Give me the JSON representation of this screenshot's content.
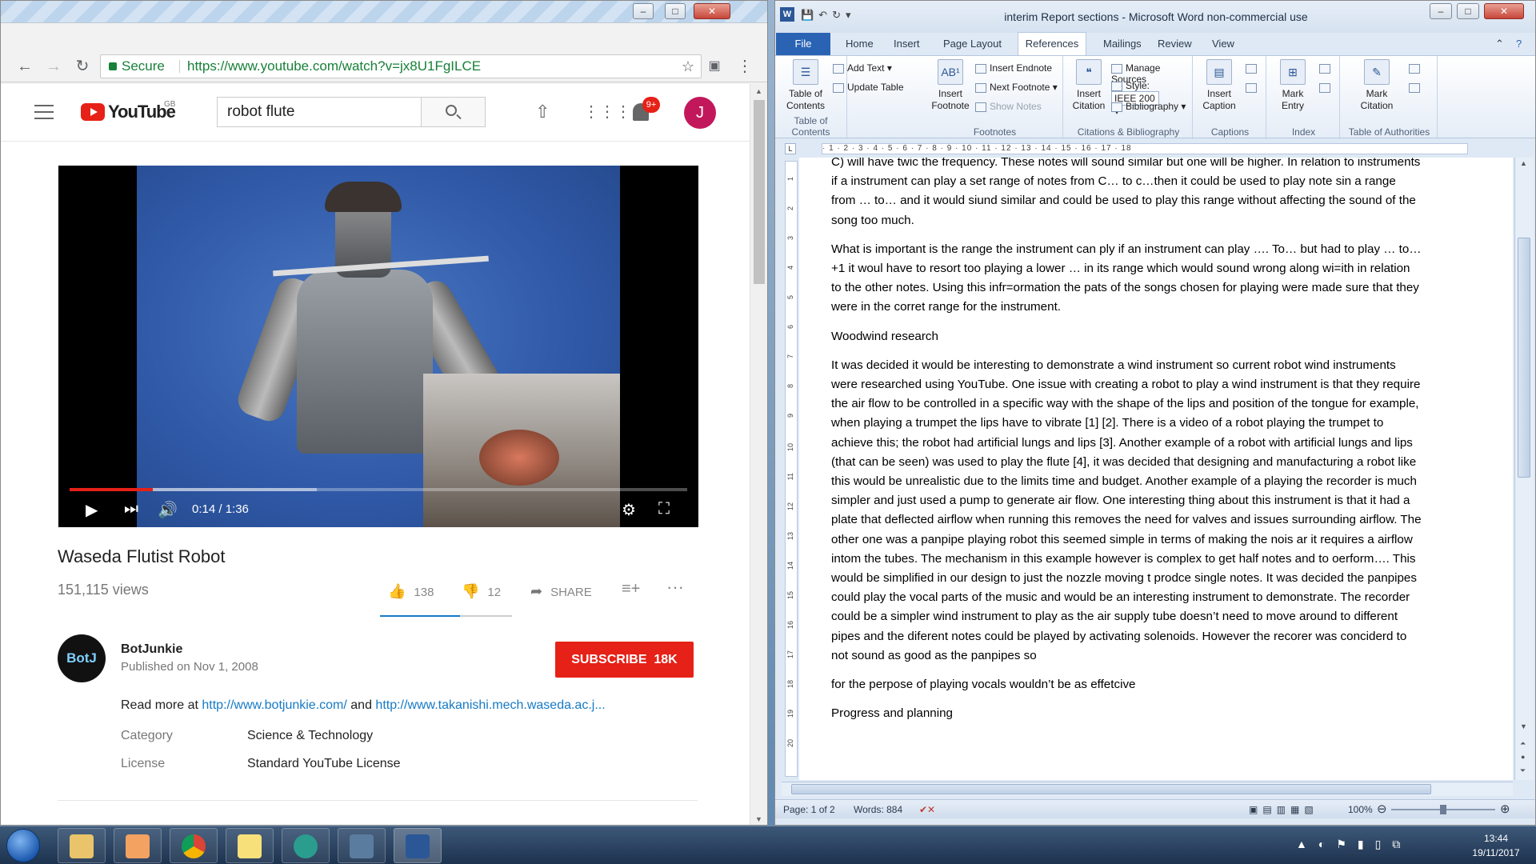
{
  "chrome": {
    "url_prefix": "Secure",
    "url": "https://www.youtube.com/watch?v=jx8U1FgILCE",
    "youtube": {
      "brand": "YouTube",
      "region": "GB",
      "search_value": "robot flute",
      "notifications": "9+",
      "avatar_letter": "J"
    },
    "video": {
      "time": "0:14 / 1:36",
      "progress_fraction": 0.135,
      "title": "Waseda Flutist Robot",
      "views": "151,115 views",
      "likes": "138",
      "dislikes": "12",
      "share": "SHARE"
    },
    "channel": {
      "avatar_text": "BotJ",
      "name": "BotJunkie",
      "published": "Published on Nov 1, 2008",
      "subscribe": "SUBSCRIBE",
      "subscribers": "18K"
    },
    "description": {
      "read_more": "Read more at",
      "link1": "http://www.botjunkie.com/",
      "and": "and",
      "link2": "http://www.takanishi.mech.waseda.ac.j..."
    },
    "meta": [
      {
        "key": "Category",
        "value": "Science & Technology"
      },
      {
        "key": "License",
        "value": "Standard YouTube License"
      }
    ]
  },
  "word": {
    "title": "interim Report sections - Microsoft Word non-commercial use",
    "tabs": {
      "file": "File",
      "home": "Home",
      "insert": "Insert",
      "page_layout": "Page Layout",
      "references": "References",
      "mailings": "Mailings",
      "review": "Review",
      "view": "View"
    },
    "ribbon": {
      "toc": {
        "label": "Table of Contents",
        "add_text": "Add Text",
        "update_table": "Update Table",
        "group": "Table of Contents"
      },
      "footnotes": {
        "insert_footnote": "Insert Footnote",
        "insert_endnote": "Insert Endnote",
        "next_footnote": "Next Footnote",
        "show_notes": "Show Notes",
        "group": "Footnotes"
      },
      "citations": {
        "insert_citation": "Insert Citation",
        "manage_sources": "Manage Sources",
        "style_label": "Style:",
        "style_value": "IEEE 200",
        "bibliography": "Bibliography",
        "group": "Citations & Bibliography"
      },
      "captions": {
        "insert_caption": "Insert Caption",
        "group": "Captions"
      },
      "index": {
        "mark_entry": "Mark Entry",
        "group": "Index"
      },
      "authorities": {
        "mark_citation": "Mark Citation",
        "group": "Table of Authorities"
      }
    },
    "ruler_text": "· 1 · 2 · 3 · 4 · 5 · 6 · 7 · 8 · 9 · 10 · 11 · 12 · 13 · 14 · 15 · 16 · 17 · 18",
    "paragraphs": [
      "C) will have twic the frequency. These notes will sound similar but one will be higher. In relation to instruments if a instrument can play a set range of notes from C… to c…then it could be used to play note sin a range from … to… and it would siund similar and could be used to play this range without affecting the sound of the song too much.",
      "What is important is the range the instrument can ply if an instrument can play …. To… but had to play … to…+1 it woul have to resort too playing a lower … in its range which would sound wrong along wi=ith in relation to the other notes. Using this infr=ormation the pats of the songs chosen for playing were made sure that they were in the corret range for the instrument.",
      "Woodwind research",
      "It was decided it would be interesting to demonstrate a wind instrument so current robot wind instruments were researched using YouTube. One issue with creating a robot to play a wind instrument is that they require the air flow to be controlled in a specific way with the shape of the lips and position of the tongue for example, when playing a trumpet the lips have to vibrate [1] [2]. There is a video of a robot playing the trumpet to achieve this; the robot had artificial lungs and lips [3]. Another example of a robot with artificial lungs and lips (that can be seen) was used to play the flute [4], it was decided that designing and manufacturing a robot like this would be unrealistic due to the limits time and budget. Another example of a playing the recorder is much simpler and just used a pump to generate air flow. One interesting thing about this instrument is that it had a plate that deflected airflow when running this removes the need for valves and issues surrounding airflow. The other one was a panpipe playing robot this seemed simple in terms of making the nois ar it requires a airflow intom the tubes. The mechanism in this example however is complex to get half notes and to oerform…. This would be simplified in our design to just the nozzle moving t prodce single notes. It was decided the panpipes could play the vocal parts of the music and would be an interesting instrument to demonstrate. The recorder could be a simpler wind instrument to play as the air supply tube doesn’t need to move around to different pipes and the diferent notes could be played by activating solenoids. However the recorer was conciderd to not sound as good as the panpipes so",
      " for the perpose of playing vocals wouldn’t be as effetcive",
      "Progress and planning"
    ],
    "status": {
      "page": "Page: 1 of 2",
      "words": "Words: 884",
      "zoom": "100%",
      "zoom_fraction": 0.5
    }
  },
  "taskbar": {
    "time": "13:44",
    "date": "19/11/2017"
  }
}
